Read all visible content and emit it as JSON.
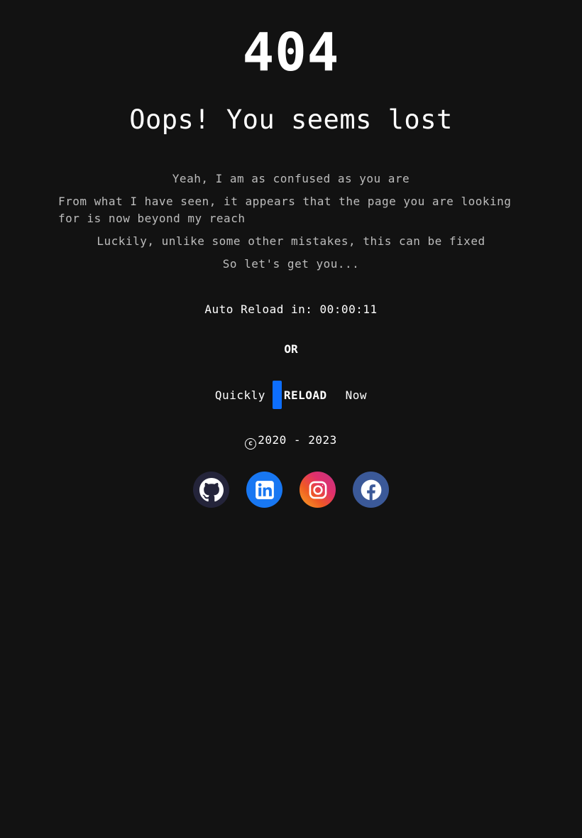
{
  "error_code": "404",
  "headline": "Oops! You seems lost",
  "paragraphs": {
    "p1": "Yeah, I am as confused as you are",
    "p2": "From what I have seen, it appears that the page you are looking for is now beyond my reach",
    "p3": "Luckily, unlike some other mistakes, this can be fixed",
    "p4": "So let's get you..."
  },
  "timer": {
    "label": "Auto Reload in: ",
    "value": "00:00:11"
  },
  "or_text": "OR",
  "reload": {
    "prefix": "Quickly",
    "button_label": "RELOAD",
    "suffix": "Now",
    "accent": "#0d6efd"
  },
  "footer": {
    "copyright_symbol": "c",
    "copyright_text": "2020 - 2023"
  },
  "social": [
    {
      "name": "github",
      "icon": "github-icon",
      "color": "#24243a"
    },
    {
      "name": "linkedin",
      "icon": "linkedin-icon",
      "color": "#1877f2"
    },
    {
      "name": "instagram",
      "icon": "instagram-icon",
      "color": "#e1306c"
    },
    {
      "name": "facebook",
      "icon": "facebook-icon",
      "color": "#3b5998"
    }
  ]
}
